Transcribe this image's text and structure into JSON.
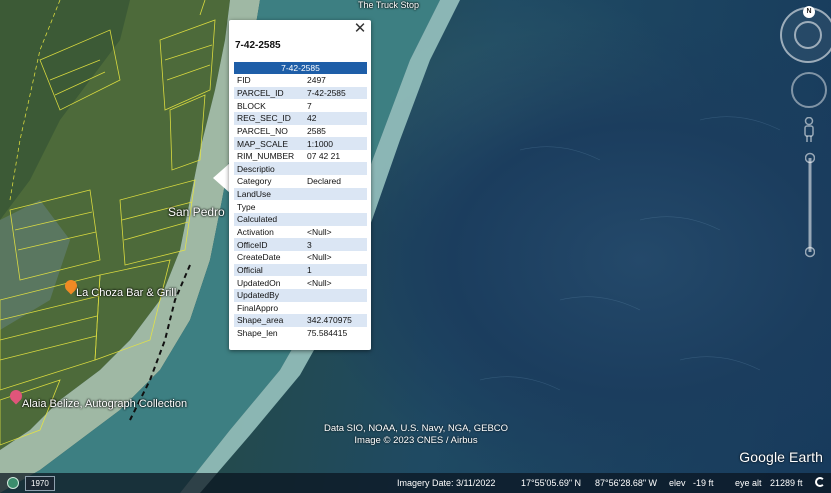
{
  "map": {
    "labels": {
      "road": "The Truck Stop",
      "town": "San Pedro",
      "restaurant": "La Choza Bar & Grill",
      "hotel": "Alaia Belize, Autograph Collection"
    },
    "parcel_outline_color": "#e8e640",
    "poi_colors": {
      "restaurant": "#f08a24",
      "hotel": "#e0557a"
    }
  },
  "balloon": {
    "close_glyph": "✕",
    "title": "7-42-2585",
    "table_header": "7-42-2585",
    "rows": [
      {
        "key": "FID",
        "value": "2497"
      },
      {
        "key": "PARCEL_ID",
        "value": "7-42-2585"
      },
      {
        "key": "BLOCK",
        "value": "7"
      },
      {
        "key": "REG_SEC_ID",
        "value": "42"
      },
      {
        "key": "PARCEL_NO",
        "value": "2585"
      },
      {
        "key": "MAP_SCALE",
        "value": "1:1000"
      },
      {
        "key": "RIM_NUMBER",
        "value": "07 42 21"
      },
      {
        "key": "Descriptio",
        "value": ""
      },
      {
        "key": "Category",
        "value": "Declared"
      },
      {
        "key": "LandUse",
        "value": ""
      },
      {
        "key": "Type",
        "value": ""
      },
      {
        "key": "Calculated",
        "value": ""
      },
      {
        "key": "Activation",
        "value": "<Null>"
      },
      {
        "key": "OfficeID",
        "value": "3"
      },
      {
        "key": "CreateDate",
        "value": "<Null>"
      },
      {
        "key": "Official",
        "value": "1"
      },
      {
        "key": "UpdatedOn",
        "value": "<Null>"
      },
      {
        "key": "UpdatedBy",
        "value": ""
      },
      {
        "key": "FinalAppro",
        "value": ""
      },
      {
        "key": "Shape_area",
        "value": "342.470975"
      },
      {
        "key": "Shape_len",
        "value": "75.584415"
      }
    ]
  },
  "nav": {
    "compass_letter": "N"
  },
  "attribution": {
    "line1": "Data SIO, NOAA, U.S. Navy, NGA, GEBCO",
    "line2": "Image © 2023 CNES / Airbus"
  },
  "brand": "Google Earth",
  "status": {
    "year": "1970",
    "imagery_date": "Imagery Date: 3/11/2022",
    "latitude": "17°55'05.69\" N",
    "longitude": "87°56'28.68\" W",
    "elev_label": "elev",
    "elev_value": "-19 ft",
    "eye_alt_label": "eye alt",
    "eye_alt_value": "21289 ft"
  }
}
